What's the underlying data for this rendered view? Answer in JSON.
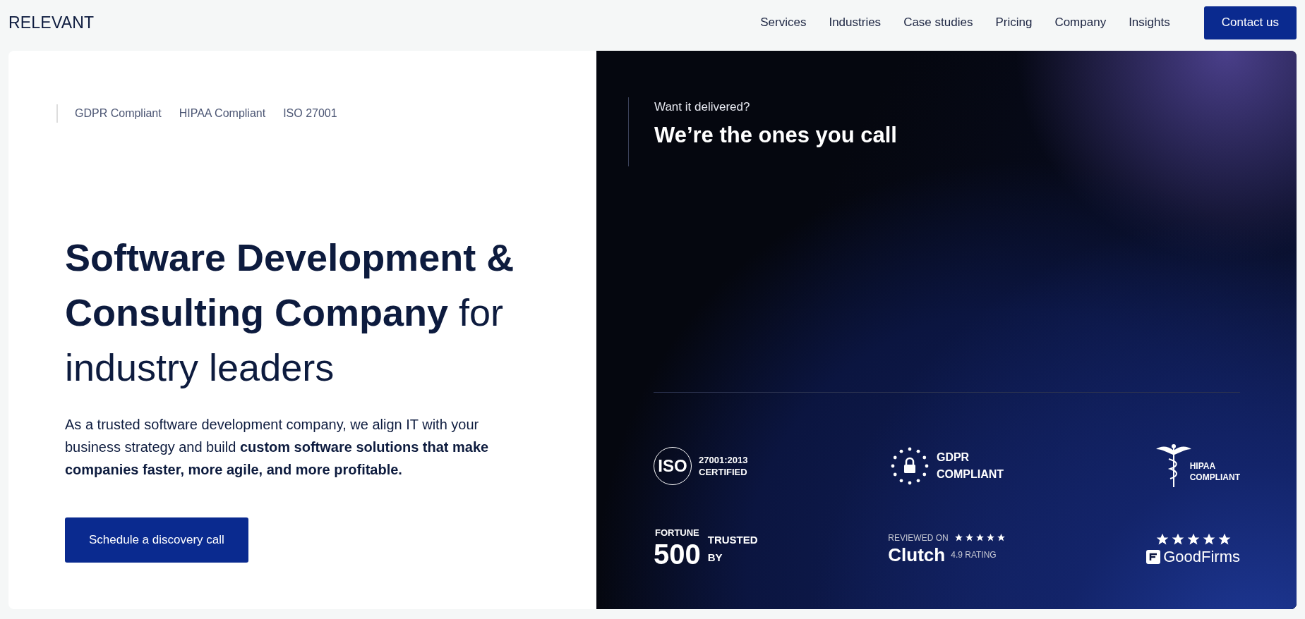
{
  "header": {
    "logo": "RELEVANT",
    "nav": [
      "Services",
      "Industries",
      "Case studies",
      "Pricing",
      "Company",
      "Insights"
    ],
    "cta": "Contact us"
  },
  "compliance": [
    "GDPR Compliant",
    "HIPAA Compliant",
    "ISO 27001"
  ],
  "hero": {
    "title_bold": "Software Development & Consulting Company",
    "title_rest": "for industry leaders",
    "text": "As a trusted software development company, we align IT with your business strategy and build **custom software solutions that make companies faster, more agile, and more profitable.**",
    "button": "Schedule a discovery call"
  },
  "promo": {
    "eyebrow": "Want it delivered?",
    "title": "We’re the ones you call"
  },
  "badges": [
    {
      "kind": "iso",
      "mark": "ISO",
      "lines": [
        "27001:2013",
        "CERTIFIED"
      ]
    },
    {
      "kind": "gdpr",
      "lines": [
        "GDPR",
        "COMPLIANT"
      ]
    },
    {
      "kind": "hipaa",
      "lines": [
        "HIPAA",
        "COMPLIANT"
      ]
    },
    {
      "kind": "fortune",
      "mark": "FORTUNE",
      "number": "500",
      "lines": [
        "TRUSTED",
        "BY"
      ]
    },
    {
      "kind": "clutch",
      "label": "REVIEWED ON",
      "name": "Clutch",
      "rating": "4.9 RATING",
      "stars": 5
    },
    {
      "kind": "goodfirms",
      "name": "GoodFirms",
      "stars": 5
    }
  ]
}
